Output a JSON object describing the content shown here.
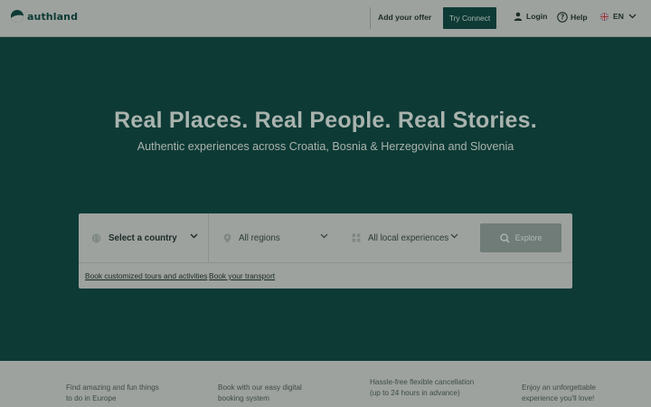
{
  "header": {
    "brand": "authland",
    "add_offer": "Add your offer",
    "try_connect": "Try Connect",
    "login": "Login",
    "help": "Help",
    "language": "EN",
    "icons": {
      "logo": "authland-leaf-logo",
      "login": "user-icon",
      "help": "question-circle-icon",
      "language": "uk-flag-icon",
      "language_dropdown": "chevron-down-icon"
    }
  },
  "hero": {
    "title": "Real Places. Real People. Real Stories.",
    "subtitle": "Authentic experiences across Croatia, Bosnia & Herzegovina and Slovenia"
  },
  "search": {
    "country": {
      "label": "Select a country",
      "icon": "globe-icon"
    },
    "regions": {
      "label": "All regions",
      "icon": "map-pin-icon"
    },
    "experiences": {
      "label": "All local experiences",
      "icon": "grid-icon"
    },
    "explore_label": "Explore",
    "links": {
      "tours": "Book customized tours and activities",
      "transport": "Book your transport"
    }
  },
  "benefits": [
    "Find amazing and fun things to do in Europe",
    "Book with our easy digital booking system",
    "Hassle-free flexible cancellation (up to 24 hours in advance)",
    "Enjoy an unforgettable experience you'll love!"
  ],
  "colors": {
    "overlay_dark": "#0e3a35",
    "overlay_light": "#9da29e",
    "button_dark": "#0e3a35",
    "explore_button": "#6f7c78"
  }
}
